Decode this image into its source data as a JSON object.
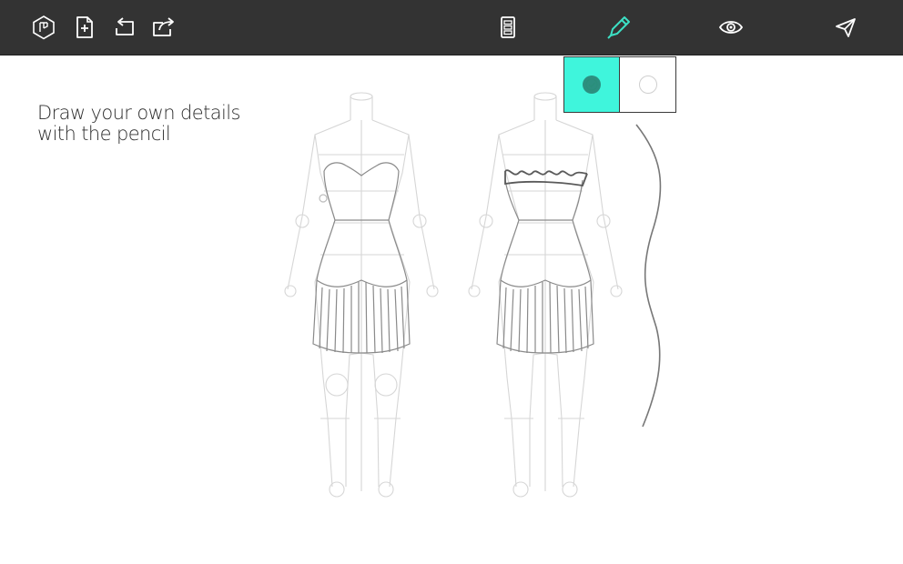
{
  "toolbar": {
    "logo_icon": "hexagon-logo-icon",
    "new_icon": "new-document-icon",
    "undo_icon": "undo-icon",
    "share_icon": "share-icon",
    "layers_icon": "layers-icon",
    "pencil_icon": "pencil-icon",
    "preview_icon": "eye-icon",
    "send_icon": "send-icon",
    "active_color": "#3ce0c4",
    "icon_color": "#ffffff"
  },
  "hint": {
    "line1": "Draw your own details",
    "line2": "with the pencil"
  },
  "color_picker": {
    "options": [
      {
        "name": "teal",
        "swatch": "#3ff5dc",
        "dot": "#2d8f80",
        "selected": true
      },
      {
        "name": "white",
        "swatch": "#ffffff",
        "dot": "#ffffff",
        "selected": false
      }
    ]
  }
}
